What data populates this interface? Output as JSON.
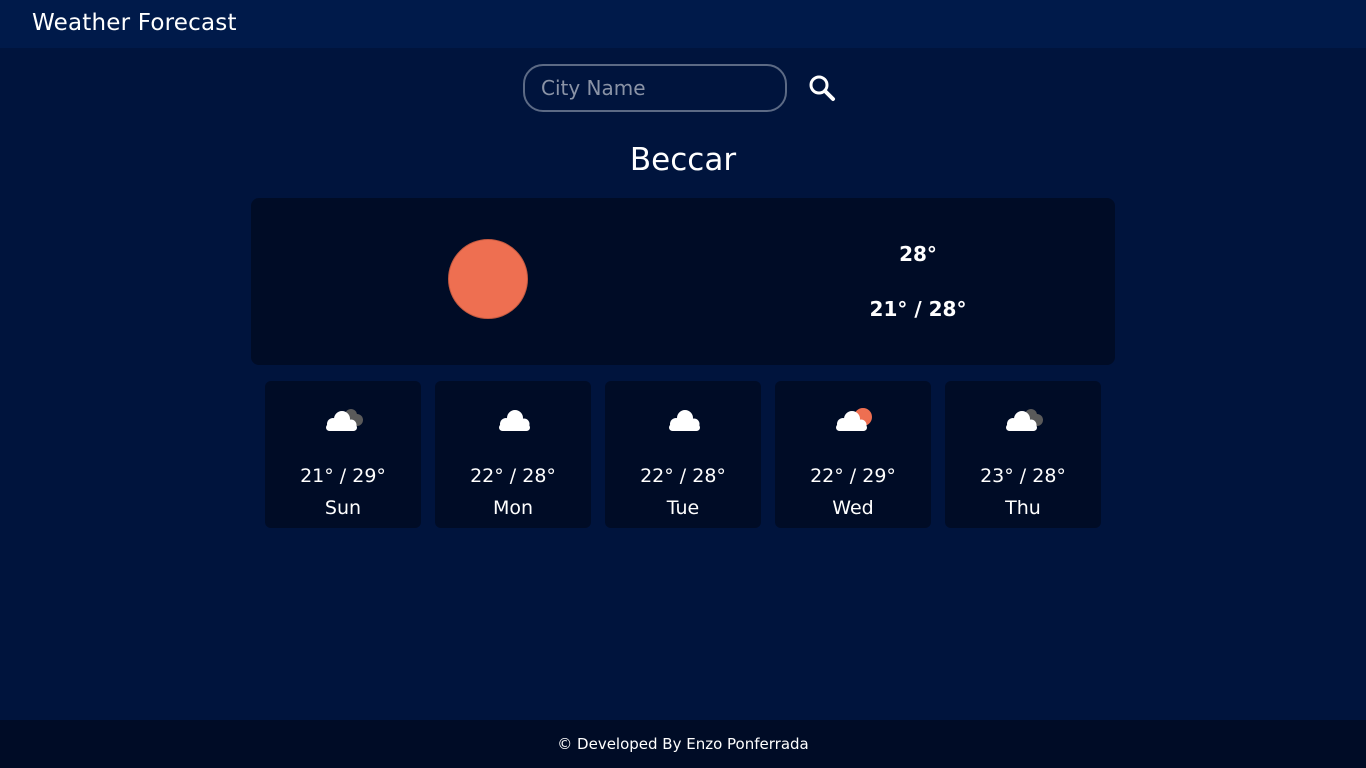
{
  "header": {
    "title": "Weather Forecast"
  },
  "search": {
    "placeholder": "City Name",
    "value": ""
  },
  "city": "Beccar",
  "current": {
    "icon": "sun-icon",
    "temp": "28°",
    "range": "21° / 28°"
  },
  "forecast": [
    {
      "range": "21° / 29°",
      "day": "Sun",
      "icon": "overcast-cloud-icon"
    },
    {
      "range": "22° / 28°",
      "day": "Mon",
      "icon": "cloud-icon"
    },
    {
      "range": "22° / 28°",
      "day": "Tue",
      "icon": "cloud-icon"
    },
    {
      "range": "22° / 29°",
      "day": "Wed",
      "icon": "partly-sunny-icon"
    },
    {
      "range": "23° / 28°",
      "day": "Thu",
      "icon": "overcast-cloud-icon"
    }
  ],
  "footer": {
    "text": "© Developed By Enzo Ponferrada"
  },
  "colors": {
    "background": "#00143d",
    "card": "#000c26",
    "sun": "#ee6f51",
    "cloud": "#ffffff",
    "dark_cloud": "#5a5a5a"
  }
}
